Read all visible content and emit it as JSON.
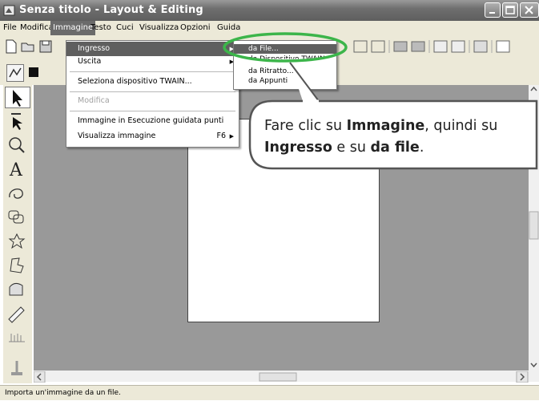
{
  "window": {
    "title": "Senza titolo - Layout & Editing"
  },
  "menubar": {
    "items": [
      "File",
      "Modifica",
      "Immagine",
      "Testo",
      "Cuci",
      "Visualizza",
      "Opzioni",
      "Guida"
    ],
    "active": "Immagine"
  },
  "immagine_menu": {
    "items": [
      {
        "label": "Ingresso",
        "state": "highlighted",
        "submenu": true
      },
      {
        "label": "Uscita",
        "submenu": true
      },
      {
        "label": "Seleziona dispositivo TWAIN..."
      },
      {
        "label": "Modifica",
        "state": "disabled"
      },
      {
        "label": "Immagine in Esecuzione guidata punti"
      },
      {
        "label": "Visualizza immagine",
        "shortcut": "F6",
        "submenu": true
      }
    ]
  },
  "ingresso_submenu": {
    "items": [
      "da File...",
      "da Dispositivo TWAIN...",
      "da Ritratto...",
      "da Appunti"
    ],
    "highlighted": "da File..."
  },
  "callout": {
    "part1": "Fare clic su ",
    "bold1": "Immagine",
    "part2": ", quindi su",
    "bold2": "Ingresso",
    "part3": " e su ",
    "bold3": "da file",
    "part4": "."
  },
  "status": {
    "text": "Importa un'immagine da un file."
  },
  "colors": {
    "highlight_ring": "#3cb54a",
    "workarea": "#999999",
    "menu_highlight": "#5f5f5f"
  },
  "icons": [
    "app-icon",
    "minimize-icon",
    "maximize-icon",
    "close-icon",
    "new-doc-icon",
    "open-icon",
    "save-icon",
    "select-arrow-icon",
    "point-edit-icon",
    "zoom-icon",
    "text-icon",
    "freehand-icon",
    "shape-icon",
    "stamp-icon",
    "outline-icon",
    "manual-punch-icon",
    "ruler-icon",
    "stitch-icon",
    "pin-icon"
  ]
}
